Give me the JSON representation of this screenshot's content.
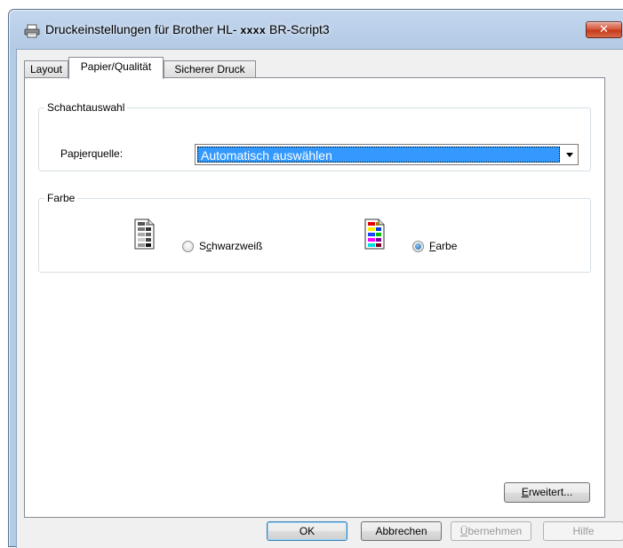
{
  "window": {
    "title_prefix": "Druckeinstellungen für Brother HL-",
    "title_mask": "xxxx",
    "title_suffix": "BR-Script3",
    "close_symbol": "✕"
  },
  "tabs": [
    {
      "label": "Layout",
      "active": false
    },
    {
      "label": "Papier/Qualität",
      "active": true
    },
    {
      "label": "Sicherer Druck",
      "active": false
    }
  ],
  "tray_group": {
    "title": "Schachtauswahl",
    "paper_source_label_pre": "Pap",
    "paper_source_label_key": "i",
    "paper_source_label_post": "erquelle:",
    "paper_source_value": "Automatisch auswählen"
  },
  "color_group": {
    "title": "Farbe",
    "bw_label_pre": "S",
    "bw_label_key": "c",
    "bw_label_post": "hwarzweiß",
    "color_label_key": "F",
    "color_label_post": "arbe",
    "selected": "color"
  },
  "buttons": {
    "advanced_key": "E",
    "advanced_rest": "rweitert...",
    "ok": "OK",
    "cancel": "Abbrechen",
    "apply_key": "Ü",
    "apply_rest": "bernehmen",
    "help": "Hilfe"
  },
  "icons": {
    "printer": "printer-icon",
    "bw_doc": "grayscale-document-icon",
    "color_doc": "color-document-icon"
  }
}
